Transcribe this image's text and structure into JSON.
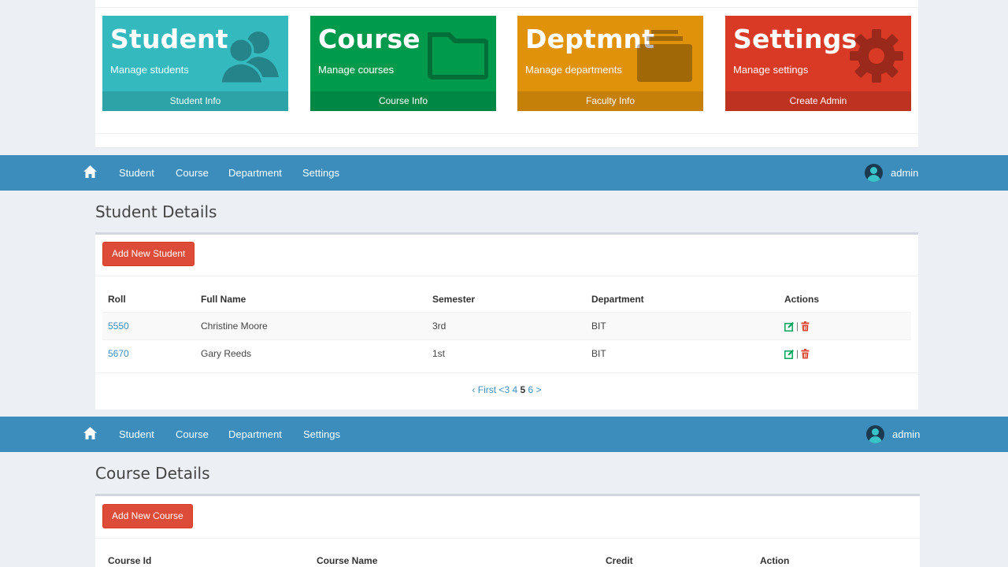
{
  "tiles": [
    {
      "title": "Student",
      "subtitle": "Manage students",
      "footer": "Student Info",
      "icon": "users-icon",
      "color": "#34b9bf"
    },
    {
      "title": "Course",
      "subtitle": "Manage courses",
      "footer": "Course Info",
      "icon": "folder-icon",
      "color": "#009a4d"
    },
    {
      "title": "Deptmnt",
      "subtitle": "Manage departments",
      "footer": "Faculty Info",
      "icon": "archive-icon",
      "color": "#e0920b"
    },
    {
      "title": "Settings",
      "subtitle": "Manage settings",
      "footer": "Create Admin",
      "icon": "gear-icon",
      "color": "#d83a26"
    }
  ],
  "nav": {
    "items": [
      "Student",
      "Course",
      "Department",
      "Settings"
    ],
    "user": "admin",
    "home_icon": "home-icon",
    "bar_color": "#3c8dbc"
  },
  "student_section": {
    "title": "Student Details",
    "add_button": "Add New Student",
    "columns": [
      "Roll",
      "Full Name",
      "Semester",
      "Department",
      "Actions"
    ],
    "rows": [
      {
        "roll": "5550",
        "name": "Christine Moore",
        "semester": "3rd",
        "department": "BIT"
      },
      {
        "roll": "5670",
        "name": "Gary Reeds",
        "semester": "1st",
        "department": "BIT"
      }
    ],
    "pagination": {
      "first": "‹ First",
      "prev": "<",
      "pages": [
        "3",
        "4",
        "5",
        "6"
      ],
      "current": "5",
      "next": ">"
    }
  },
  "course_section": {
    "title": "Course Details",
    "add_button": "Add New Course",
    "columns": [
      "Course Id",
      "Course Name",
      "Credit",
      "Action"
    ]
  },
  "colors": {
    "danger": "#dd4b39",
    "edit_icon": "#00a65a",
    "delete_icon": "#dd4b39"
  }
}
